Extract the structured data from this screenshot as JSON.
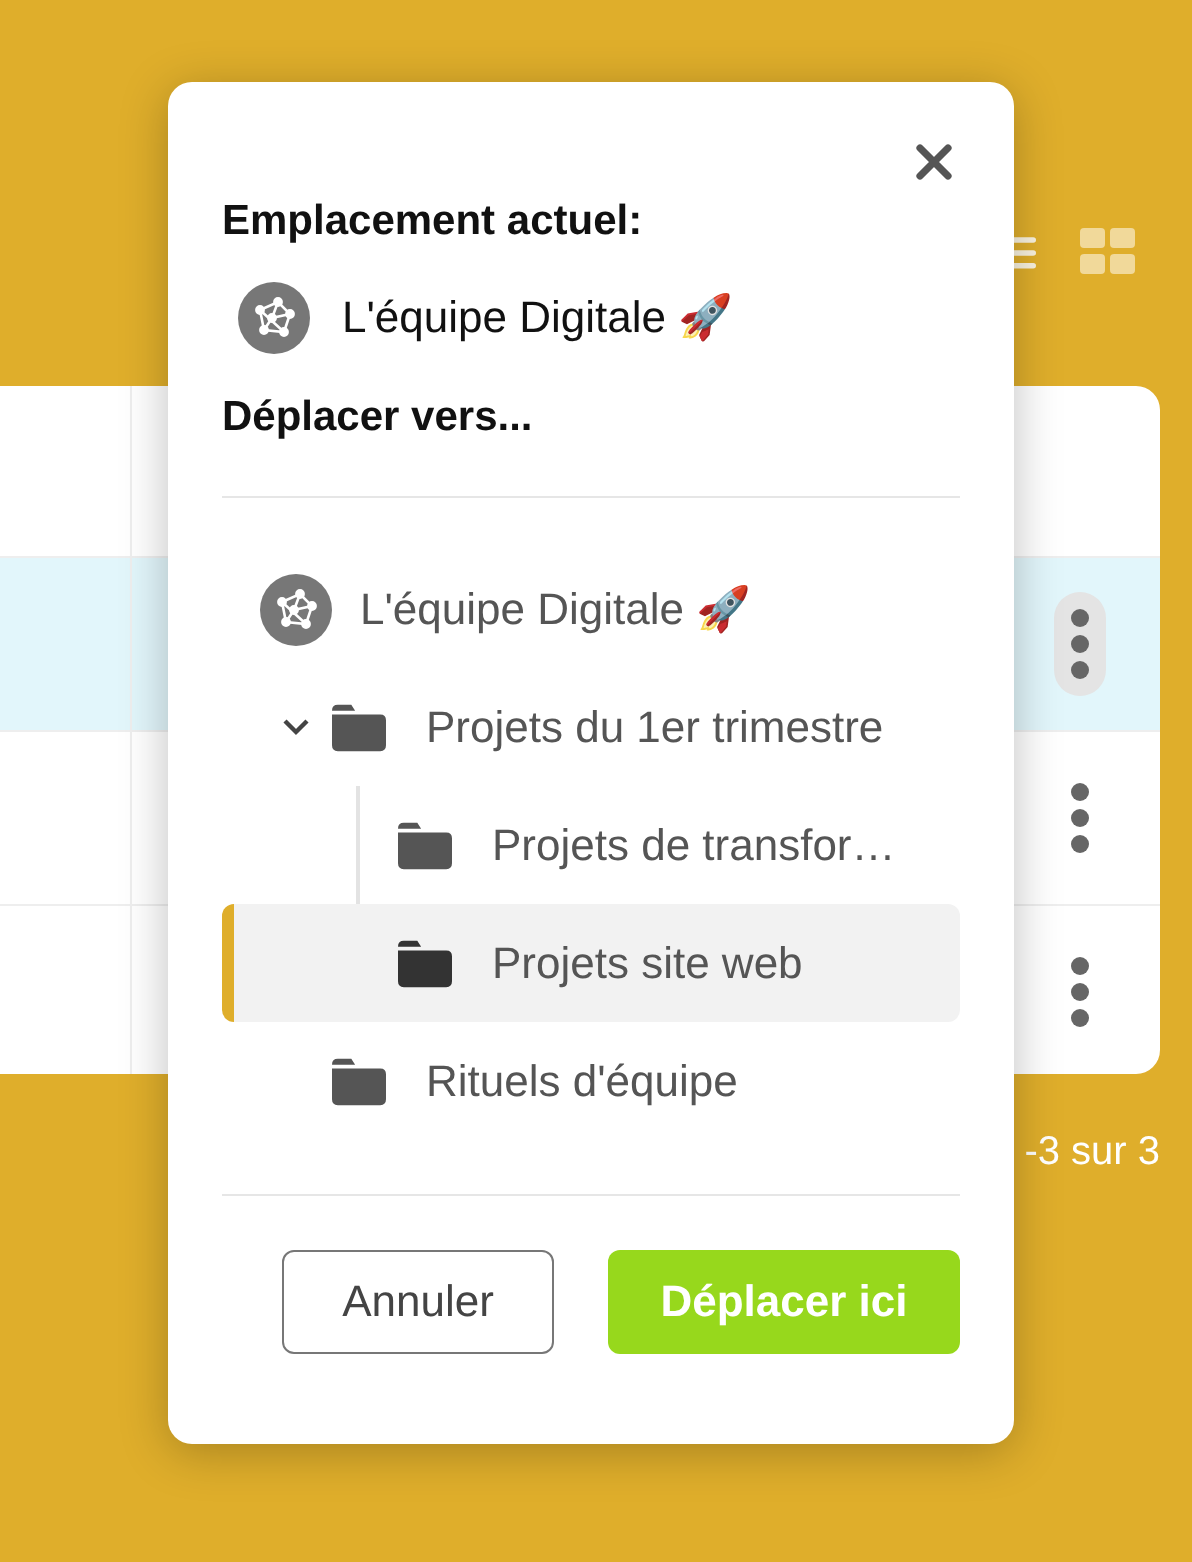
{
  "background": {
    "rows": [
      {
        "selected": true
      },
      {
        "selected": false
      },
      {
        "selected": false
      }
    ],
    "pagination": "-3 sur 3"
  },
  "dialog": {
    "current_label": "Emplacement actuel:",
    "current": {
      "name": "L'équipe Digitale 🚀"
    },
    "target_label": "Déplacer vers...",
    "tree": {
      "kind": "team",
      "name": "L'équipe Digitale 🚀",
      "selected": false,
      "children": [
        {
          "kind": "folder",
          "name": "Projets du 1er trimestre",
          "expanded": true,
          "selected": false,
          "children": [
            {
              "kind": "folder",
              "name": "Projets de transfor…",
              "selected": false
            },
            {
              "kind": "folder",
              "name": "Projets site web",
              "selected": true
            }
          ]
        },
        {
          "kind": "folder",
          "name": "Rituels d'équipe",
          "selected": false
        }
      ]
    },
    "buttons": [
      {
        "label": "Annuler",
        "kind": "secondary"
      },
      {
        "label": "Déplacer ici",
        "kind": "primary"
      }
    ]
  }
}
